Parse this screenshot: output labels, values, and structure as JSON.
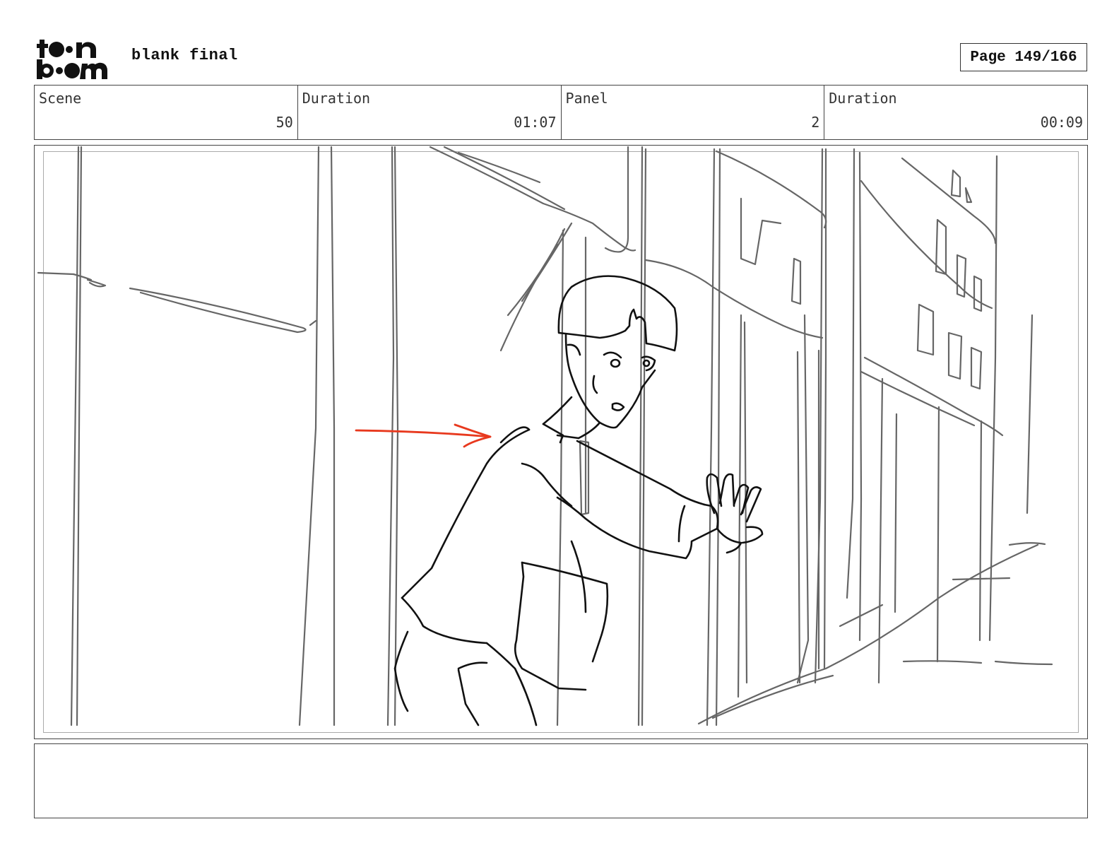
{
  "header": {
    "logo_text": "toon boom",
    "project_title": "blank final",
    "page_label": "Page 149/166"
  },
  "info": {
    "scene_label": "Scene",
    "scene_value": "50",
    "scene_duration_label": "Duration",
    "scene_duration_value": "01:07",
    "panel_label": "Panel",
    "panel_value": "2",
    "panel_duration_label": "Duration",
    "panel_duration_value": "00:09"
  },
  "panel": {
    "image": "storyboard-sketch",
    "arrow_color": "#e8391e",
    "line_color": "#666666",
    "character_line_color": "#111111"
  },
  "dialogue": {
    "text": ""
  }
}
